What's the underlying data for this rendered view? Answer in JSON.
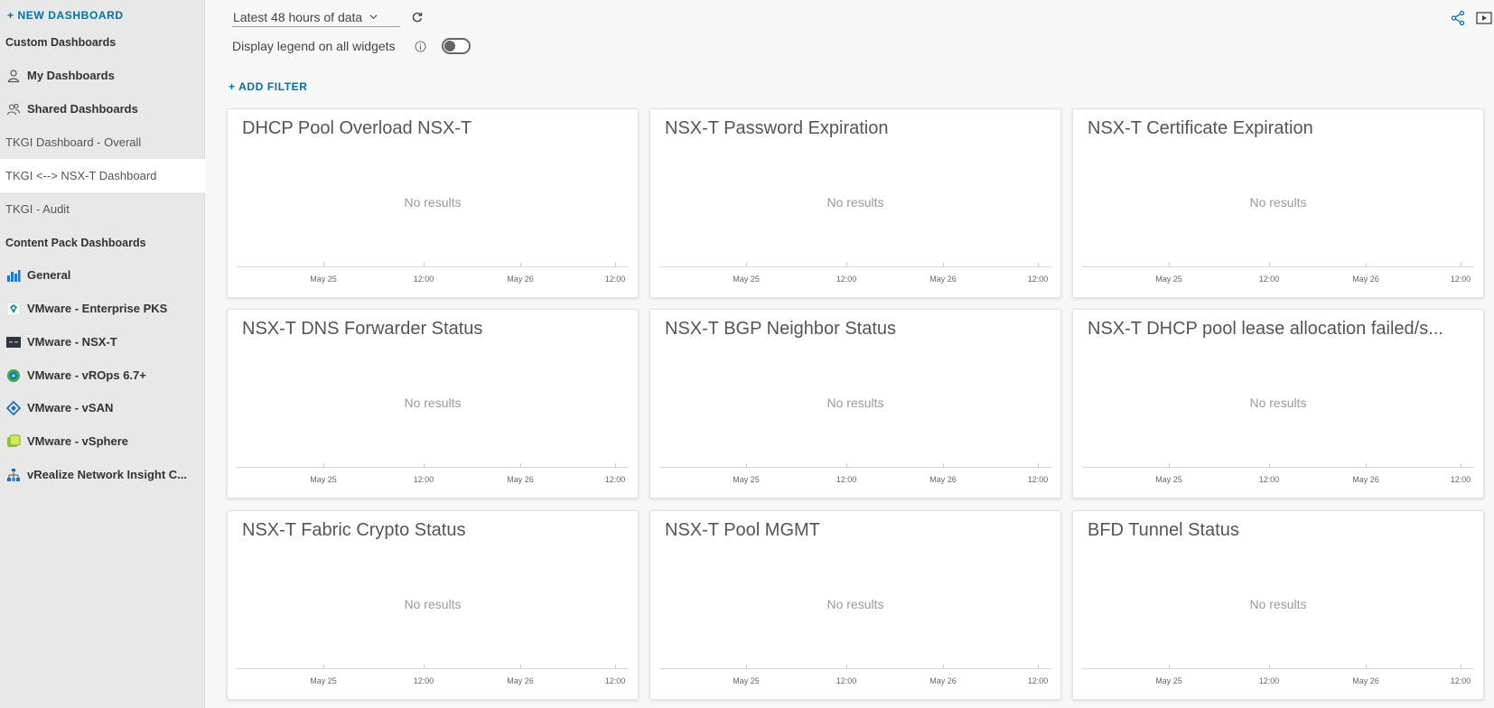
{
  "sidebar": {
    "new_dashboard": "+ NEW DASHBOARD",
    "items": [
      {
        "label": "Custom Dashboards",
        "kind": "header",
        "icon": null
      },
      {
        "label": "My Dashboards",
        "kind": "bold",
        "icon": "user-icon"
      },
      {
        "label": "Shared Dashboards",
        "kind": "bold",
        "icon": "users-icon"
      },
      {
        "label": "TKGI Dashboard - Overall",
        "kind": "plain",
        "icon": null
      },
      {
        "label": "TKGI <--> NSX-T Dashboard",
        "kind": "selected",
        "icon": null
      },
      {
        "label": "TKGI - Audit",
        "kind": "plain",
        "icon": null
      },
      {
        "label": "Content Pack Dashboards",
        "kind": "header",
        "icon": null
      },
      {
        "label": "General",
        "kind": "bold",
        "icon": "bar-chart-icon"
      },
      {
        "label": "VMware - Enterprise PKS",
        "kind": "bold",
        "icon": "pks-logo-icon"
      },
      {
        "label": "VMware - NSX-T",
        "kind": "bold",
        "icon": "nsx-logo-icon"
      },
      {
        "label": "VMware - vROps 6.7+",
        "kind": "bold",
        "icon": "vrops-logo-icon"
      },
      {
        "label": "VMware - vSAN",
        "kind": "bold",
        "icon": "vsan-logo-icon"
      },
      {
        "label": "VMware - vSphere",
        "kind": "bold",
        "icon": "vsphere-logo-icon"
      },
      {
        "label": "vRealize Network Insight C...",
        "kind": "bold",
        "icon": "network-insight-logo-icon"
      }
    ]
  },
  "toolbar": {
    "time_range": "Latest 48 hours of data",
    "legend_label": "Display legend on all widgets",
    "legend_toggle": "off",
    "add_filter": "+ ADD FILTER"
  },
  "colors": {
    "accent": "#0072a3",
    "selected_bg": "#ffffff",
    "sidebar_bg": "#e8e8e8"
  },
  "widget_axis_ticks": [
    "May 25",
    "12:00",
    "May 26",
    "12:00"
  ],
  "widgets": [
    {
      "title": "DHCP Pool Overload NSX-T",
      "empty": "No results"
    },
    {
      "title": "NSX-T Password Expiration",
      "empty": "No results"
    },
    {
      "title": "NSX-T Certificate Expiration",
      "empty": "No results"
    },
    {
      "title": "NSX-T DNS Forwarder Status",
      "empty": "No results"
    },
    {
      "title": "NSX-T BGP Neighbor Status",
      "empty": "No results"
    },
    {
      "title": "NSX-T DHCP pool lease allocation failed/s...",
      "empty": "No results"
    },
    {
      "title": "NSX-T Fabric Crypto Status",
      "empty": "No results"
    },
    {
      "title": "NSX-T Pool MGMT",
      "empty": "No results"
    },
    {
      "title": "BFD Tunnel Status",
      "empty": "No results"
    }
  ]
}
